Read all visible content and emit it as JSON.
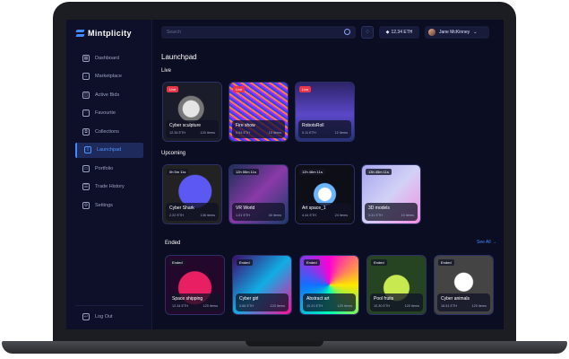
{
  "app": {
    "brand": "Mintplicity"
  },
  "sidebar": {
    "items": [
      {
        "label": "Dashboard",
        "icon": "dashboard-icon"
      },
      {
        "label": "Marketplace",
        "icon": "marketplace-icon"
      },
      {
        "label": "Active Bids",
        "icon": "gavel-icon"
      },
      {
        "label": "Favourite",
        "icon": "heart-icon"
      },
      {
        "label": "Collections",
        "icon": "collections-icon"
      },
      {
        "label": "Launchpad",
        "icon": "rocket-icon",
        "active": true
      },
      {
        "label": "Portfolio",
        "icon": "folder-icon"
      },
      {
        "label": "Trade History",
        "icon": "history-icon"
      },
      {
        "label": "Settings",
        "icon": "gear-icon"
      }
    ],
    "logout_label": "Log Out"
  },
  "topbar": {
    "search_placeholder": "Search",
    "balance": "12.34 ETH",
    "user_name": "Jane McKinney"
  },
  "page": {
    "title": "Launchpad"
  },
  "sections": {
    "live": "Live",
    "upcoming": "Upcoming",
    "ended": "Ended",
    "see_all": "See All →"
  },
  "live": [
    {
      "badge": "Live",
      "title": "Cyber sculpture",
      "price": "12.34 ETH",
      "items": "120 items"
    },
    {
      "badge": "Live",
      "title": "Fire show",
      "price": "9.54 ETH",
      "items": "15 items"
    },
    {
      "badge": "Live",
      "title": "RobotsRoll",
      "price": "0.11 ETH",
      "items": "12 items"
    }
  ],
  "upcoming": [
    {
      "badge": "0h 5m 11s",
      "title": "Cyber Shark",
      "price": "2.22 ETH",
      "items": "136 items"
    },
    {
      "badge": "12h 55m 11s",
      "title": "VR World",
      "price": "1.01 ETH",
      "items": "40 items"
    },
    {
      "badge": "12h 46m 11s",
      "title": "Art space_1",
      "price": "4.44 ETH",
      "items": "24 items"
    },
    {
      "badge": "13h 45m 11s",
      "title": "3D models",
      "price": "3.31 ETH",
      "items": "10 items"
    }
  ],
  "ended": [
    {
      "badge": "Ended",
      "title": "Space shipping",
      "price": "12.34 ETH",
      "items": "120 items"
    },
    {
      "badge": "Ended",
      "title": "Cyber girl",
      "price": "0.66 ETH",
      "items": "120 items"
    },
    {
      "badge": "Ended",
      "title": "Abstract art",
      "price": "10.21 ETH",
      "items": "120 items"
    },
    {
      "badge": "Ended",
      "title": "Pool fruits",
      "price": "10.30 ETH",
      "items": "120 items"
    },
    {
      "badge": "Ended",
      "title": "Cyber animals",
      "price": "18.51 ETH",
      "items": "120 items"
    }
  ],
  "colors": {
    "accent": "#3d8bff",
    "background": "#0b0d22",
    "sidebar": "#0e1029",
    "live_badge": "#e8364a"
  }
}
